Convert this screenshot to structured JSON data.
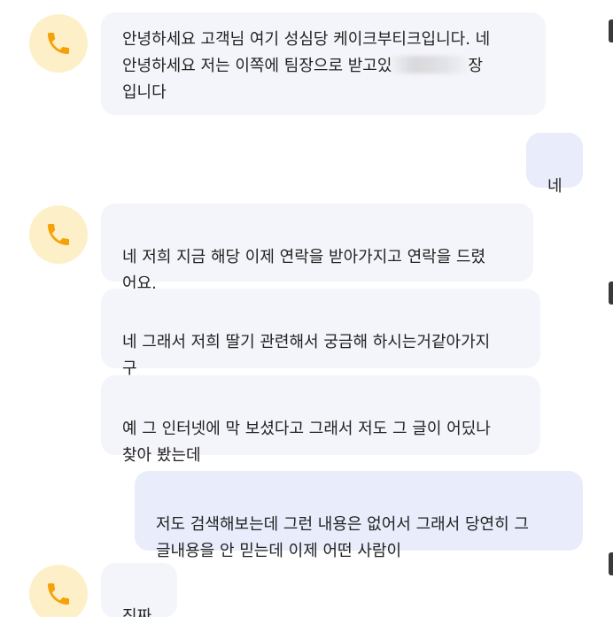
{
  "colors": {
    "incoming_bubble": "#f4f5fa",
    "outgoing_bubble": "#e8ecfb",
    "avatar_bg": "#fdf0c8",
    "phone_icon": "#f5a20a"
  },
  "icons": {
    "caller_avatar": "phone-icon"
  },
  "messages": [
    {
      "sender": "caller",
      "line1": "안녕하세요 고객님 여기 성심당 케이크부티크입니다. 네",
      "line2a": "안녕하세요 저는 이쪽에 팀장으로 받고있",
      "line2b": "장",
      "line3": "입니다"
    },
    {
      "sender": "me",
      "text": "네"
    },
    {
      "sender": "caller",
      "text": "네 저희 지금 해당 이제 연락을 받아가지고 연락을 드렸\n어요."
    },
    {
      "sender": "caller",
      "text": "네 그래서 저희 딸기 관련해서 궁금해 하시는거같아가지\n구"
    },
    {
      "sender": "caller",
      "text": "예 그 인터넷에 막 보셨다고 그래서 저도 그 글이 어딨나\n찾아 봤는데"
    },
    {
      "sender": "me",
      "text": "저도 검색해보는데 그런 내용은 없어서 그래서 당연히 그\n글내용을 안 믿는데 이제 어떤 사람이"
    },
    {
      "sender": "caller",
      "text": "진짜"
    }
  ]
}
